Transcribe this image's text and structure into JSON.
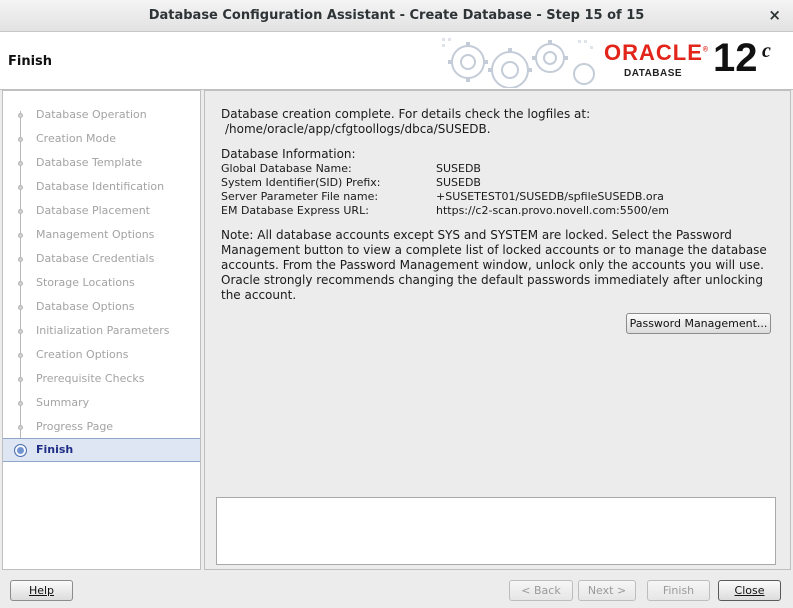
{
  "window": {
    "title": "Database Configuration Assistant - Create Database - Step 15 of 15",
    "close_glyph": "×"
  },
  "banner": {
    "step_title": "Finish",
    "logo_word": "ORACLE",
    "logo_reg": "®",
    "logo_sub": "DATABASE",
    "version": "12",
    "version_sup": "c"
  },
  "nav": {
    "items": [
      {
        "label": "Database Operation"
      },
      {
        "label": "Creation Mode"
      },
      {
        "label": "Database Template"
      },
      {
        "label": "Database Identification"
      },
      {
        "label": "Database Placement"
      },
      {
        "label": "Management Options"
      },
      {
        "label": "Database Credentials"
      },
      {
        "label": "Storage Locations"
      },
      {
        "label": "Database Options"
      },
      {
        "label": "Initialization Parameters"
      },
      {
        "label": "Creation Options"
      },
      {
        "label": "Prerequisite Checks"
      },
      {
        "label": "Summary"
      },
      {
        "label": "Progress Page"
      },
      {
        "label": "Finish"
      }
    ],
    "active_index": 14
  },
  "main": {
    "completion_line1": "Database creation complete. For details check the logfiles at:",
    "completion_line2": "/home/oracle/app/cfgtoollogs/dbca/SUSEDB.",
    "info_heading": "Database Information:",
    "info": [
      {
        "key": "Global Database Name:",
        "value": "SUSEDB"
      },
      {
        "key": "System Identifier(SID) Prefix:",
        "value": "SUSEDB"
      },
      {
        "key": "Server Parameter File name:",
        "value": "+SUSETEST01/SUSEDB/spfileSUSEDB.ora"
      },
      {
        "key": "EM Database Express URL:",
        "value": "https://c2-scan.provo.novell.com:5500/em"
      }
    ],
    "note": "Note: All database accounts except SYS and SYSTEM are locked. Select the Password Management button to view a complete list of locked accounts or to manage the database accounts. From the Password Management window, unlock only the accounts you will use. Oracle strongly recommends changing the default passwords immediately after unlocking the account.",
    "password_button": "Password Management..."
  },
  "footer": {
    "help": "Help",
    "back": "< Back",
    "next": "Next >",
    "finish": "Finish",
    "close": "Close"
  }
}
